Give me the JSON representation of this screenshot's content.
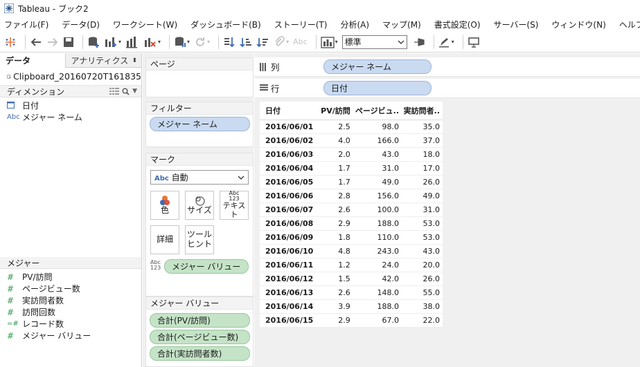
{
  "window": {
    "title": "Tableau - ブック2"
  },
  "menu": [
    "ファイル(F)",
    "データ(D)",
    "ワークシート(W)",
    "ダッシュボード(B)",
    "ストーリー(T)",
    "分析(A)",
    "マップ(M)",
    "書式設定(O)",
    "サーバー(S)",
    "ウィンドウ(N)",
    "ヘルプ(H)"
  ],
  "toolbar": {
    "fit_value": "標準",
    "text_button": "Abc"
  },
  "data_pane": {
    "tabs": [
      "データ",
      "アナリティクス"
    ],
    "datasource": "Clipboard_20160720T161835",
    "dimensions_label": "ディメンション",
    "dimensions": [
      {
        "icon": "date-icon",
        "type": "日",
        "name": "日付"
      },
      {
        "icon": "text-icon",
        "type": "Abc",
        "name": "メジャー ネーム"
      }
    ],
    "measures_label": "メジャー",
    "measures": [
      {
        "type": "#",
        "name": "PV/訪問"
      },
      {
        "type": "#",
        "name": "ページビュー数"
      },
      {
        "type": "#",
        "name": "実訪問者数"
      },
      {
        "type": "#",
        "name": "訪問回数"
      },
      {
        "type": "=#",
        "name": "レコード数"
      },
      {
        "type": "#",
        "name": "メジャー バリュー"
      }
    ]
  },
  "shelves": {
    "pages_label": "ページ",
    "filters_label": "フィルター",
    "filter_pill": "メジャー ネーム",
    "marks_label": "マーク",
    "mark_type": "自動",
    "mark_type_prefix": "Abc",
    "mark_buttons": {
      "color": "色",
      "size": "サイズ",
      "text": "テキスト",
      "text_icon": "Abc 123",
      "detail": "詳細",
      "tooltip_line1": "ツール",
      "tooltip_line2": "ヒント"
    },
    "mark_text_pill": "メジャー バリュー",
    "measure_values_label": "メジャー バリュー",
    "measure_values": [
      "合計(PV/訪問)",
      "合計(ページビュー数)",
      "合計(実訪問者数)"
    ],
    "columns_label": "列",
    "columns_pill": "メジャー ネーム",
    "rows_label": "行",
    "rows_pill": "日付"
  },
  "table": {
    "headers": [
      "日付",
      "PV/訪問",
      "ページビュ..",
      "実訪問者.."
    ],
    "rows": [
      [
        "2016/06/01",
        "2.5",
        "98.0",
        "35.0"
      ],
      [
        "2016/06/02",
        "4.0",
        "166.0",
        "37.0"
      ],
      [
        "2016/06/03",
        "2.0",
        "43.0",
        "18.0"
      ],
      [
        "2016/06/04",
        "1.7",
        "31.0",
        "17.0"
      ],
      [
        "2016/06/05",
        "1.7",
        "49.0",
        "26.0"
      ],
      [
        "2016/06/06",
        "2.8",
        "156.0",
        "49.0"
      ],
      [
        "2016/06/07",
        "2.6",
        "100.0",
        "31.0"
      ],
      [
        "2016/06/08",
        "2.9",
        "188.0",
        "53.0"
      ],
      [
        "2016/06/09",
        "1.8",
        "110.0",
        "53.0"
      ],
      [
        "2016/06/10",
        "4.8",
        "243.0",
        "43.0"
      ],
      [
        "2016/06/11",
        "1.2",
        "24.0",
        "20.0"
      ],
      [
        "2016/06/12",
        "1.5",
        "42.0",
        "26.0"
      ],
      [
        "2016/06/13",
        "2.6",
        "148.0",
        "55.0"
      ],
      [
        "2016/06/14",
        "3.9",
        "188.0",
        "38.0"
      ],
      [
        "2016/06/15",
        "2.9",
        "67.0",
        "22.0"
      ]
    ]
  },
  "colors": {
    "pill_blue": "#c9daf1",
    "pill_green": "#c4e3c7",
    "measure_green": "#2f9c4a",
    "dimension_blue": "#3f6cb4"
  }
}
